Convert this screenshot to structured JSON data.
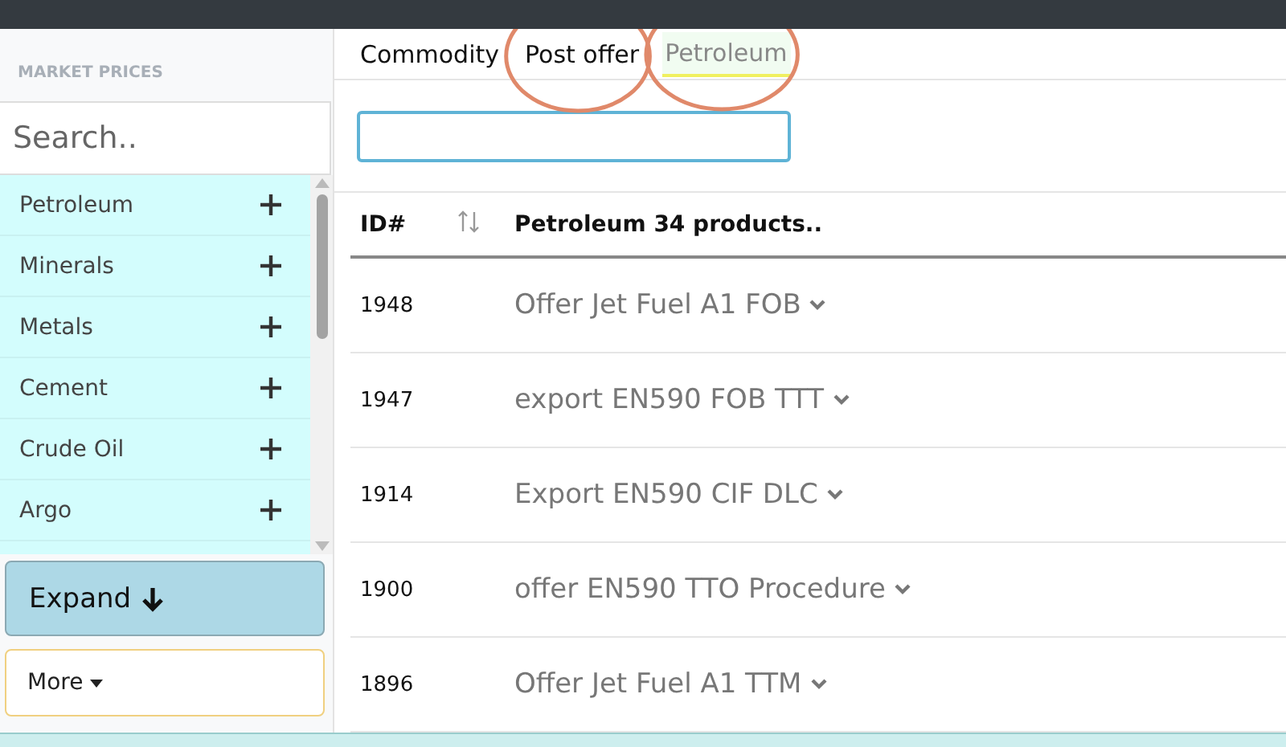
{
  "sidebar": {
    "heading": "MARKET PRICES",
    "search": {
      "placeholder": "Search.."
    },
    "items": [
      {
        "label": "Petroleum",
        "expanded": false
      },
      {
        "label": "Minerals",
        "expanded": false
      },
      {
        "label": "Metals",
        "expanded": false
      },
      {
        "label": "Cement",
        "expanded": false
      },
      {
        "label": "Crude Oil",
        "expanded": false
      },
      {
        "label": "Argo",
        "expanded": false
      }
    ],
    "expand_button": "Expand",
    "more_button": "More"
  },
  "tabs": [
    {
      "label": "Commodity",
      "selected": false,
      "circled": false
    },
    {
      "label": "Post offer",
      "selected": false,
      "circled": true
    },
    {
      "label": "Petroleum",
      "selected": true,
      "circled": true
    }
  ],
  "table": {
    "columns": [
      "ID#",
      "Petroleum 34 products.."
    ],
    "rows": [
      {
        "id": "1948",
        "title": "Offer Jet Fuel A1 FOB"
      },
      {
        "id": "1947",
        "title": "export EN590 FOB TTT"
      },
      {
        "id": "1914",
        "title": "Export EN590 CIF DLC"
      },
      {
        "id": "1900",
        "title": "offer EN590 TTO Procedure"
      },
      {
        "id": "1896",
        "title": "Offer Jet Fuel A1 TTM"
      }
    ]
  }
}
